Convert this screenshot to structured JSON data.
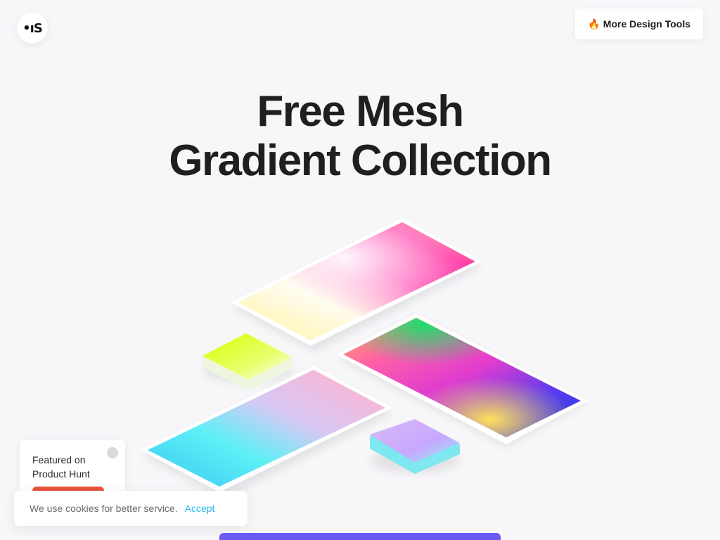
{
  "header": {
    "logo_text": "•ıS",
    "tools_button": {
      "icon": "fire-icon",
      "icon_glyph": "🔥",
      "label": "More Design Tools"
    }
  },
  "hero": {
    "title_line1": "Free Mesh",
    "title_line2": "Gradient Collection"
  },
  "product_hunt": {
    "line1": "Featured on",
    "line2": "Product Hunt",
    "close_icon": "close-icon",
    "badge_color": "#e8533a"
  },
  "cookie_banner": {
    "message": "We use cookies for better service.",
    "accept_label": "Accept",
    "accent_color": "#29b6e8"
  },
  "cta": {
    "color": "#6b57f2"
  },
  "colors": {
    "background": "#f7f7fa",
    "title": "#1f1f1f"
  }
}
